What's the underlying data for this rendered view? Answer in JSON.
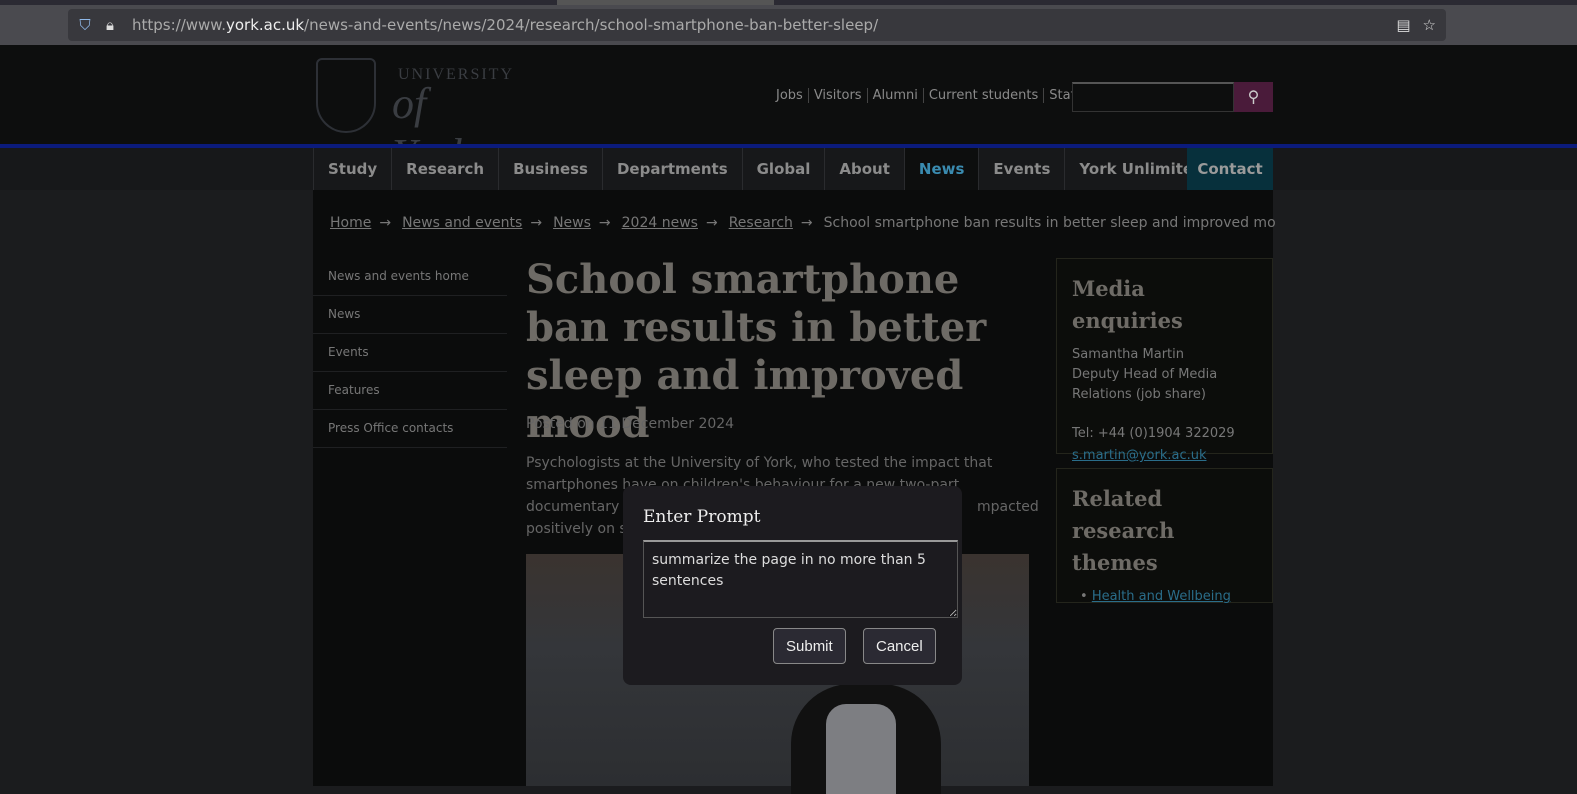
{
  "browser": {
    "url_prefix": "https://www.",
    "url_domain": "york.ac.uk",
    "url_path": "/news-and-events/news/2024/research/school-smartphone-ban-better-sleep/"
  },
  "header": {
    "logo_text": "University of York",
    "top_links": [
      "Jobs",
      "Visitors",
      "Alumni",
      "Current students",
      "Staff"
    ]
  },
  "nav": {
    "items": [
      "Study",
      "Research",
      "Business",
      "Departments",
      "Global",
      "About",
      "News",
      "Events",
      "York Unlimited"
    ],
    "active": "News",
    "contact": "Contact"
  },
  "breadcrumb": {
    "items": [
      "Home",
      "News and events",
      "News",
      "2024 news",
      "Research"
    ],
    "current": "School smartphone ban results in better sleep and improved mo"
  },
  "sidebar": {
    "items": [
      "News and events home",
      "News",
      "Events",
      "Features",
      "Press Office contacts"
    ]
  },
  "article": {
    "title": "School smartphone ban results in better sleep and improved mood",
    "posted": "Posted on 11 December 2024",
    "intro_lines": [
      "Psychologists at the University of York, who tested the impact that",
      "smartphones have on children's behaviour for a new two-part",
      "documentary s",
      "positively on s"
    ],
    "intro_right": "mpacted"
  },
  "media": {
    "title": "Media enquiries",
    "name": "Samantha Martin",
    "role_1": "Deputy Head of Media",
    "role_2": "Relations (job share)",
    "tel": "Tel: +44 (0)1904 322029",
    "email": "s.martin@york.ac.uk"
  },
  "related": {
    "title": "Related research themes",
    "items": [
      "Health and Wellbeing"
    ]
  },
  "modal": {
    "title": "Enter Prompt",
    "value": "summarize the page in no more than 5 sentences",
    "submit": "Submit",
    "cancel": "Cancel"
  }
}
